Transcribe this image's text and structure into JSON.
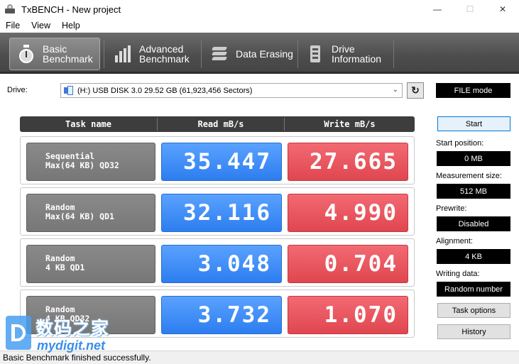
{
  "window": {
    "title": "TxBENCH - New project",
    "minimize_glyph": "—",
    "maximize_glyph": "☐",
    "close_glyph": "✕"
  },
  "menu": [
    "File",
    "View",
    "Help"
  ],
  "tabs": [
    {
      "line1": "Basic",
      "line2": "Benchmark",
      "icon": "stopwatch-icon",
      "active": true
    },
    {
      "line1": "Advanced",
      "line2": "Benchmark",
      "icon": "bar-chart-icon",
      "active": false
    },
    {
      "line1": "Data Erasing",
      "line2": "",
      "icon": "eraser-icon",
      "active": false
    },
    {
      "line1": "Drive",
      "line2": "Information",
      "icon": "drive-icon",
      "active": false
    }
  ],
  "drive": {
    "label": "Drive:",
    "selected": "(H:) USB DISK 3.0  29.52 GB (61,923,456 Sectors)",
    "mode": "FILE mode"
  },
  "table": {
    "headers": [
      "Task name",
      "Read mB/s",
      "Write mB/s"
    ],
    "rows": [
      {
        "task_line1": "Sequential",
        "task_line2": "Max(64 KB) QD32",
        "read": "35.447",
        "write": "27.665"
      },
      {
        "task_line1": "Random",
        "task_line2": "Max(64 KB) QD1",
        "read": "32.116",
        "write": "4.990"
      },
      {
        "task_line1": "Random",
        "task_line2": "4 KB QD1",
        "read": "3.048",
        "write": "0.704"
      },
      {
        "task_line1": "Random",
        "task_line2": "4 KB QD32",
        "read": "3.732",
        "write": "1.070"
      }
    ]
  },
  "panel": {
    "start": "Start",
    "start_position_label": "Start position:",
    "start_position": "0 MB",
    "measurement_size_label": "Measurement size:",
    "measurement_size": "512 MB",
    "prewrite_label": "Prewrite:",
    "prewrite": "Disabled",
    "alignment_label": "Alignment:",
    "alignment": "4 KB",
    "writing_data_label": "Writing data:",
    "writing_data": "Random number",
    "task_options": "Task options",
    "history": "History"
  },
  "status": "Basic Benchmark finished successfully.",
  "watermark": {
    "cn": "数码之家",
    "en": "mydigit.net"
  },
  "colors": {
    "read": "#2d7df0",
    "write": "#e0464f",
    "tabbar": "#4d4d4d"
  }
}
